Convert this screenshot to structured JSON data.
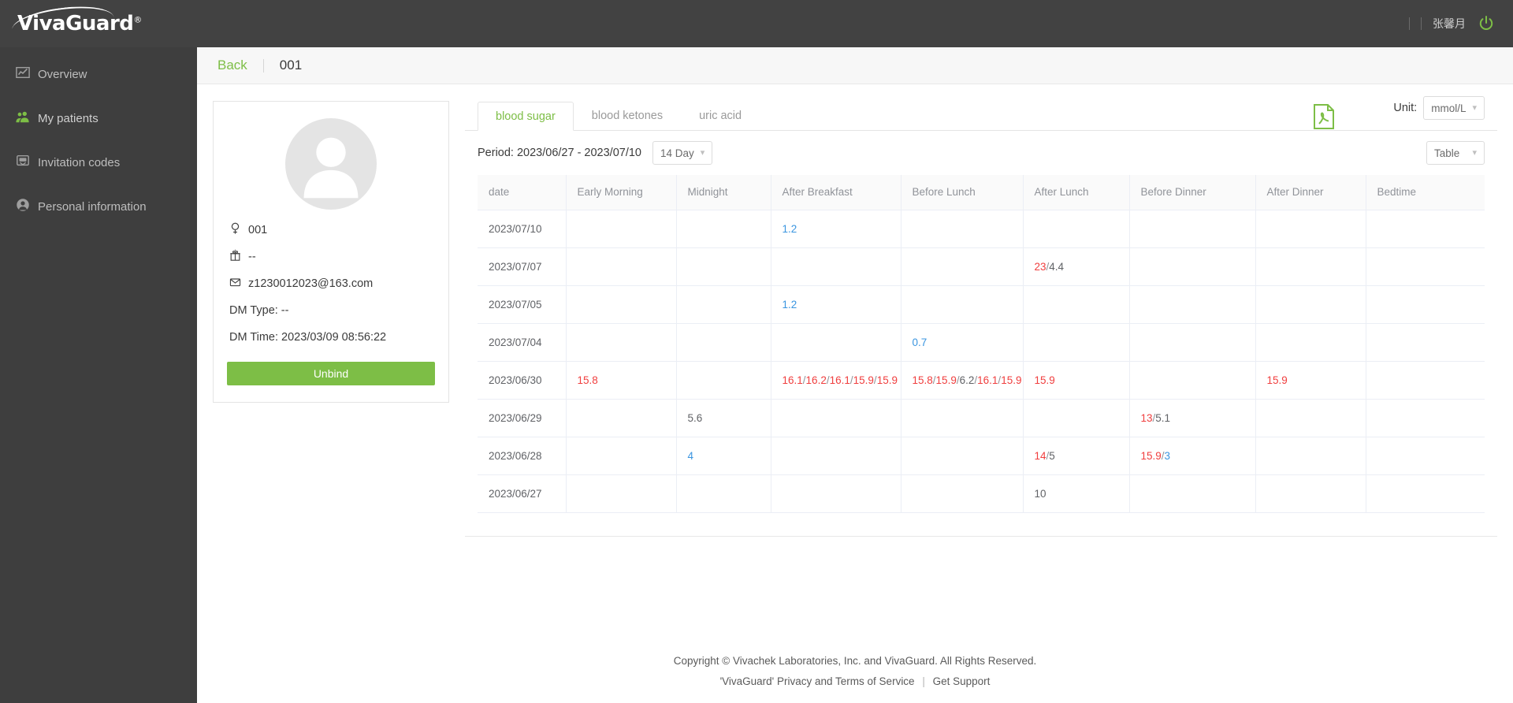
{
  "topbar": {
    "brand": "VivaGuard",
    "brand_sup": "®",
    "user_name": "张馨月",
    "power_icon": "power-icon"
  },
  "sidebar": {
    "items": [
      {
        "label": "Overview",
        "icon": "chart-icon",
        "active": false
      },
      {
        "label": "My patients",
        "icon": "users-icon",
        "active": true
      },
      {
        "label": "Invitation codes",
        "icon": "envelope-chat-icon",
        "active": false
      },
      {
        "label": "Personal information",
        "icon": "user-circle-icon",
        "active": false
      }
    ]
  },
  "page_head": {
    "back_label": "Back",
    "title": "001"
  },
  "patient": {
    "avatar_icon": "avatar-placeholder-icon",
    "gender_icon": "female-icon",
    "id": "001",
    "birthday_icon": "gift-icon",
    "birthday": "--",
    "email_icon": "envelope-icon",
    "email": "z1230012023@163.com",
    "dm_type": "DM Type: --",
    "dm_time": "DM Time: 2023/03/09 08:56:22",
    "unbind_label": "Unbind"
  },
  "panel": {
    "tabs": [
      {
        "label": "blood sugar",
        "active": true
      },
      {
        "label": "blood ketones",
        "active": false
      },
      {
        "label": "uric acid",
        "active": false
      }
    ],
    "period_text": "Period: 2023/06/27 - 2023/07/10",
    "range_select": "14 Day",
    "pdf_icon": "pdf-export-icon",
    "unit_label": "Unit:",
    "unit_select": "mmol/L",
    "view_select": "Table"
  },
  "table": {
    "columns": [
      "date",
      "Early Morning",
      "Midnight",
      "After Breakfast",
      "Before Lunch",
      "After Lunch",
      "Before Dinner",
      "After Dinner",
      "Bedtime"
    ],
    "rows": [
      {
        "date": "2023/07/10",
        "cells": [
          [],
          [],
          [
            {
              "v": "1.2",
              "s": "low"
            }
          ],
          [],
          [],
          [],
          [],
          []
        ]
      },
      {
        "date": "2023/07/07",
        "cells": [
          [],
          [],
          [],
          [],
          [
            {
              "v": "23",
              "s": "high"
            },
            {
              "v": "4.4",
              "s": "norm"
            }
          ],
          [],
          [],
          []
        ]
      },
      {
        "date": "2023/07/05",
        "cells": [
          [],
          [],
          [
            {
              "v": "1.2",
              "s": "low"
            }
          ],
          [],
          [],
          [],
          [],
          []
        ]
      },
      {
        "date": "2023/07/04",
        "cells": [
          [],
          [],
          [],
          [
            {
              "v": "0.7",
              "s": "low"
            }
          ],
          [],
          [],
          [],
          []
        ]
      },
      {
        "date": "2023/06/30",
        "cells": [
          [
            {
              "v": "15.8",
              "s": "high"
            }
          ],
          [],
          [
            {
              "v": "16.1",
              "s": "high"
            },
            {
              "v": "16.2",
              "s": "high"
            },
            {
              "v": "16.1",
              "s": "high"
            },
            {
              "v": "15.9",
              "s": "high"
            },
            {
              "v": "15.9",
              "s": "high"
            }
          ],
          [
            {
              "v": "15.8",
              "s": "high"
            },
            {
              "v": "15.9",
              "s": "high"
            },
            {
              "v": "6.2",
              "s": "norm"
            },
            {
              "v": "16.1",
              "s": "high"
            },
            {
              "v": "15.9",
              "s": "high"
            }
          ],
          [
            {
              "v": "15.9",
              "s": "high"
            }
          ],
          [],
          [
            {
              "v": "15.9",
              "s": "high"
            }
          ],
          []
        ]
      },
      {
        "date": "2023/06/29",
        "cells": [
          [],
          [
            {
              "v": "5.6",
              "s": "norm"
            }
          ],
          [],
          [],
          [],
          [
            {
              "v": "13",
              "s": "high"
            },
            {
              "v": "5.1",
              "s": "norm"
            }
          ],
          [],
          []
        ]
      },
      {
        "date": "2023/06/28",
        "cells": [
          [],
          [
            {
              "v": "4",
              "s": "low"
            }
          ],
          [],
          [],
          [
            {
              "v": "14",
              "s": "high"
            },
            {
              "v": "5",
              "s": "norm"
            }
          ],
          [
            {
              "v": "15.9",
              "s": "high"
            },
            {
              "v": "3",
              "s": "low"
            }
          ],
          [],
          []
        ]
      },
      {
        "date": "2023/06/27",
        "cells": [
          [],
          [],
          [],
          [],
          [
            {
              "v": "10",
              "s": "norm"
            }
          ],
          [],
          [],
          []
        ]
      }
    ]
  },
  "footer": {
    "line1": "Copyright © Vivachek Laboratories, Inc. and VivaGuard. All Rights Reserved.",
    "privacy": "'VivaGuard' Privacy and Terms of Service",
    "support": "Get Support"
  },
  "colors": {
    "accent_green": "#7dbe46",
    "high": "#f03e3e",
    "low": "#3a95e0",
    "normal": "#606266",
    "sidebar_bg": "#3e3e3e",
    "topbar_bg": "#424242"
  }
}
